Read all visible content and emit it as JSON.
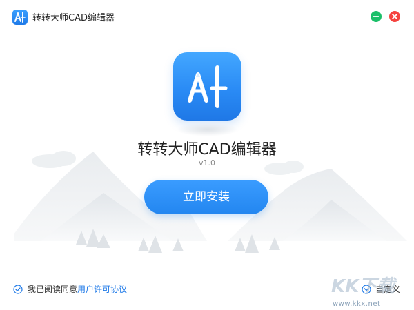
{
  "window": {
    "title": "转转大师CAD编辑器",
    "minimize_icon": "minimize-icon",
    "close_icon": "close-icon"
  },
  "app": {
    "name": "转转大师CAD编辑器",
    "version": "v1.0",
    "logo_text": "A|",
    "logo_color": "#2a8bf5"
  },
  "actions": {
    "install_label": "立即安装",
    "custom_label": "自定义"
  },
  "agreement": {
    "prefix": "我已阅读同意",
    "link": "用户许可协议",
    "checked": true
  },
  "watermark": {
    "logo_text": "KK下载",
    "url": "www.kkx.net"
  },
  "colors": {
    "accent": "#2386f0",
    "minimize": "#1bbf69",
    "close": "#f5433f",
    "link": "#1f7ae8"
  }
}
